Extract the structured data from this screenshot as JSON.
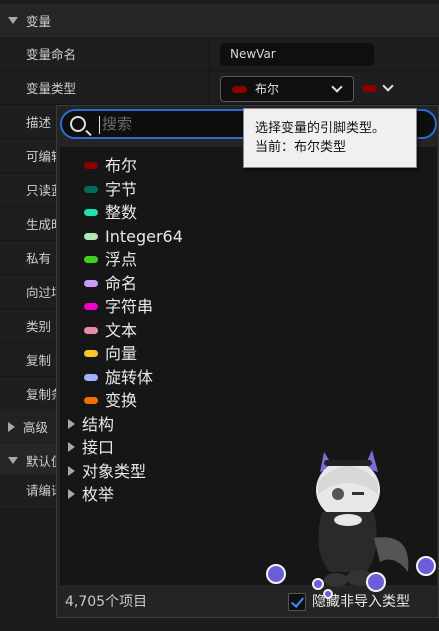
{
  "section_variable": {
    "title": "变量"
  },
  "properties": [
    {
      "label": "变量命名"
    },
    {
      "label": "变量类型"
    },
    {
      "label": "描述"
    },
    {
      "label": "可编辑"
    },
    {
      "label": "只读蓝图"
    },
    {
      "label": "生成时公开"
    },
    {
      "label": "私有"
    },
    {
      "label": "向过场动画公开"
    },
    {
      "label": "类别"
    },
    {
      "label": "复制"
    },
    {
      "label": "复制条件"
    }
  ],
  "section_advanced": {
    "title": "高级"
  },
  "section_default": {
    "title": "默认值"
  },
  "default_hint": "请编译蓝图",
  "variable_name": {
    "value": "NewVar"
  },
  "variable_type": {
    "label": "布尔",
    "color": "#8b0000"
  },
  "search": {
    "placeholder": "搜索"
  },
  "tooltip": {
    "line1": "选择变量的引脚类型。",
    "line2": "当前：布尔类型"
  },
  "types": [
    {
      "label": "布尔",
      "color": "#8b0000"
    },
    {
      "label": "字节",
      "color": "#006b5e"
    },
    {
      "label": "整数",
      "color": "#1fe0b0"
    },
    {
      "label": "Integer64",
      "color": "#b0e6b0"
    },
    {
      "label": "浮点",
      "color": "#3fcf1e"
    },
    {
      "label": "命名",
      "color": "#c89cf8"
    },
    {
      "label": "字符串",
      "color": "#f000c8"
    },
    {
      "label": "文本",
      "color": "#e88aa8"
    },
    {
      "label": "向量",
      "color": "#f8c828"
    },
    {
      "label": "旋转体",
      "color": "#a0b0ff"
    },
    {
      "label": "变换",
      "color": "#f07000"
    }
  ],
  "categories": [
    {
      "label": "结构"
    },
    {
      "label": "接口"
    },
    {
      "label": "对象类型"
    },
    {
      "label": "枚举"
    }
  ],
  "footer": {
    "count": "4,705个项目",
    "checkbox_label": "隐藏非导入类型",
    "checked": true
  },
  "icons": [
    "triangle-down-icon",
    "triangle-right-icon",
    "chevron-down-icon",
    "search-icon",
    "checkmark-icon"
  ]
}
